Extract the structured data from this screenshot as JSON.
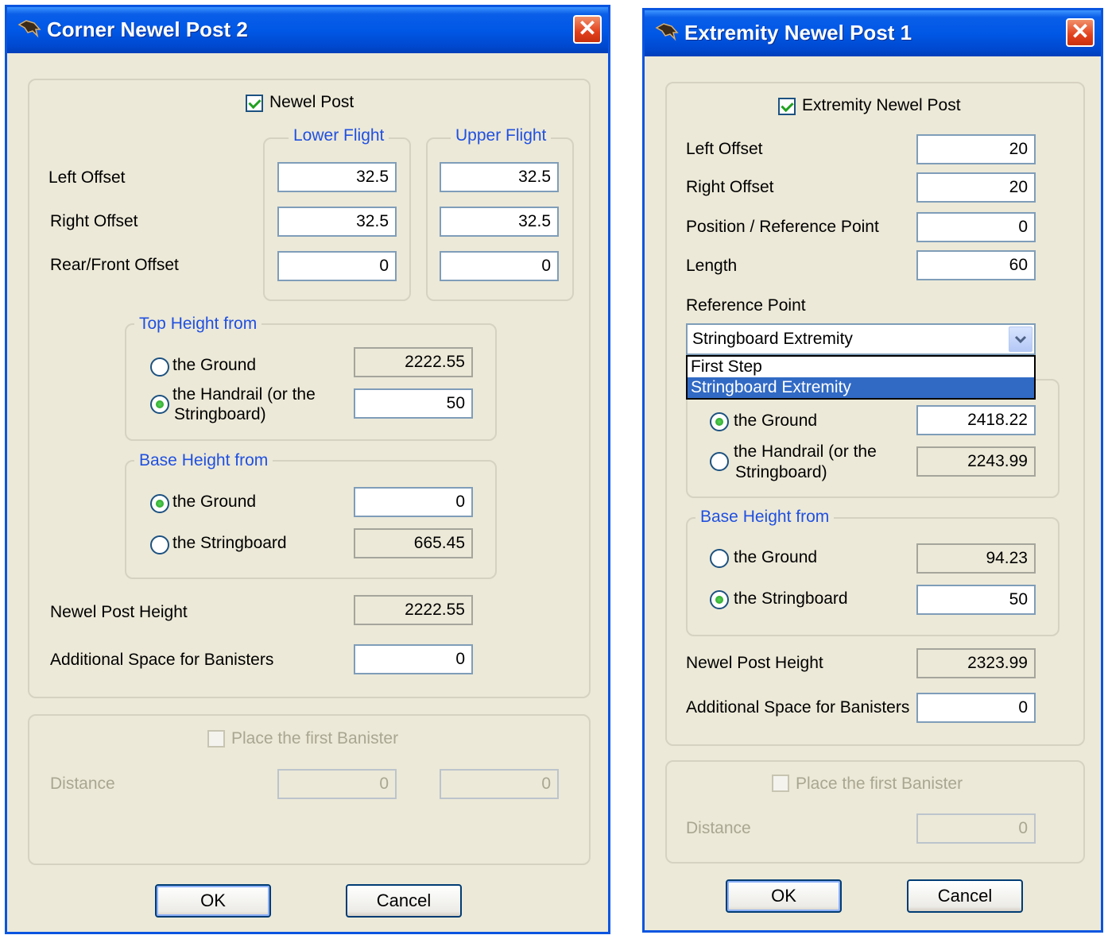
{
  "dialog1": {
    "title": "Corner Newel Post 2",
    "close": "✕",
    "newel_checkbox": "Newel Post",
    "lower_flight": "Lower Flight",
    "upper_flight": "Upper Flight",
    "labels": {
      "left": "Left Offset",
      "right": "Right Offset",
      "rear": "Rear/Front Offset"
    },
    "lower": {
      "left": "32.5",
      "right": "32.5",
      "rear": "0"
    },
    "upper": {
      "left": "32.5",
      "right": "32.5",
      "rear": "0"
    },
    "top_height": {
      "legend": "Top Height from",
      "ground": "the Ground",
      "ground_val": "2222.55",
      "handrail_1": "the Handrail (or the",
      "handrail_2": "Stringboard)",
      "handrail_val": "50"
    },
    "base_height": {
      "legend": "Base Height from",
      "ground": "the Ground",
      "ground_val": "0",
      "stringboard": "the Stringboard",
      "stringboard_val": "665.45"
    },
    "newel_height_label": "Newel Post Height",
    "newel_height_val": "2222.55",
    "additional_label": "Additional Space for Banisters",
    "additional_val": "0",
    "place_banister": "Place the first Banister",
    "distance_label": "Distance",
    "distance_1": "0",
    "distance_2": "0",
    "ok": "OK",
    "cancel": "Cancel"
  },
  "dialog2": {
    "title": "Extremity Newel Post 1",
    "close": "✕",
    "extremity_checkbox": "Extremity Newel Post",
    "left_label": "Left Offset",
    "left_val": "20",
    "right_label": "Right Offset",
    "right_val": "20",
    "position_label": "Position / Reference Point",
    "position_val": "0",
    "length_label": "Length",
    "length_val": "60",
    "ref_point_label": "Reference Point",
    "ref_point_selected": "Stringboard Extremity",
    "ref_point_options": [
      "First Step",
      "Stringboard Extremity"
    ],
    "top_height": {
      "ground": "the Ground",
      "ground_val": "2418.22",
      "handrail_1": "the Handrail (or the",
      "handrail_2": "Stringboard)",
      "handrail_val": "2243.99"
    },
    "base_height": {
      "legend": "Base Height from",
      "ground": "the Ground",
      "ground_val": "94.23",
      "stringboard": "the Stringboard",
      "stringboard_val": "50"
    },
    "newel_height_label": "Newel Post Height",
    "newel_height_val": "2323.99",
    "additional_label": "Additional Space for Banisters",
    "additional_val": "0",
    "place_banister": "Place the first Banister",
    "distance_label": "Distance",
    "distance_val": "0",
    "ok": "OK",
    "cancel": "Cancel"
  }
}
